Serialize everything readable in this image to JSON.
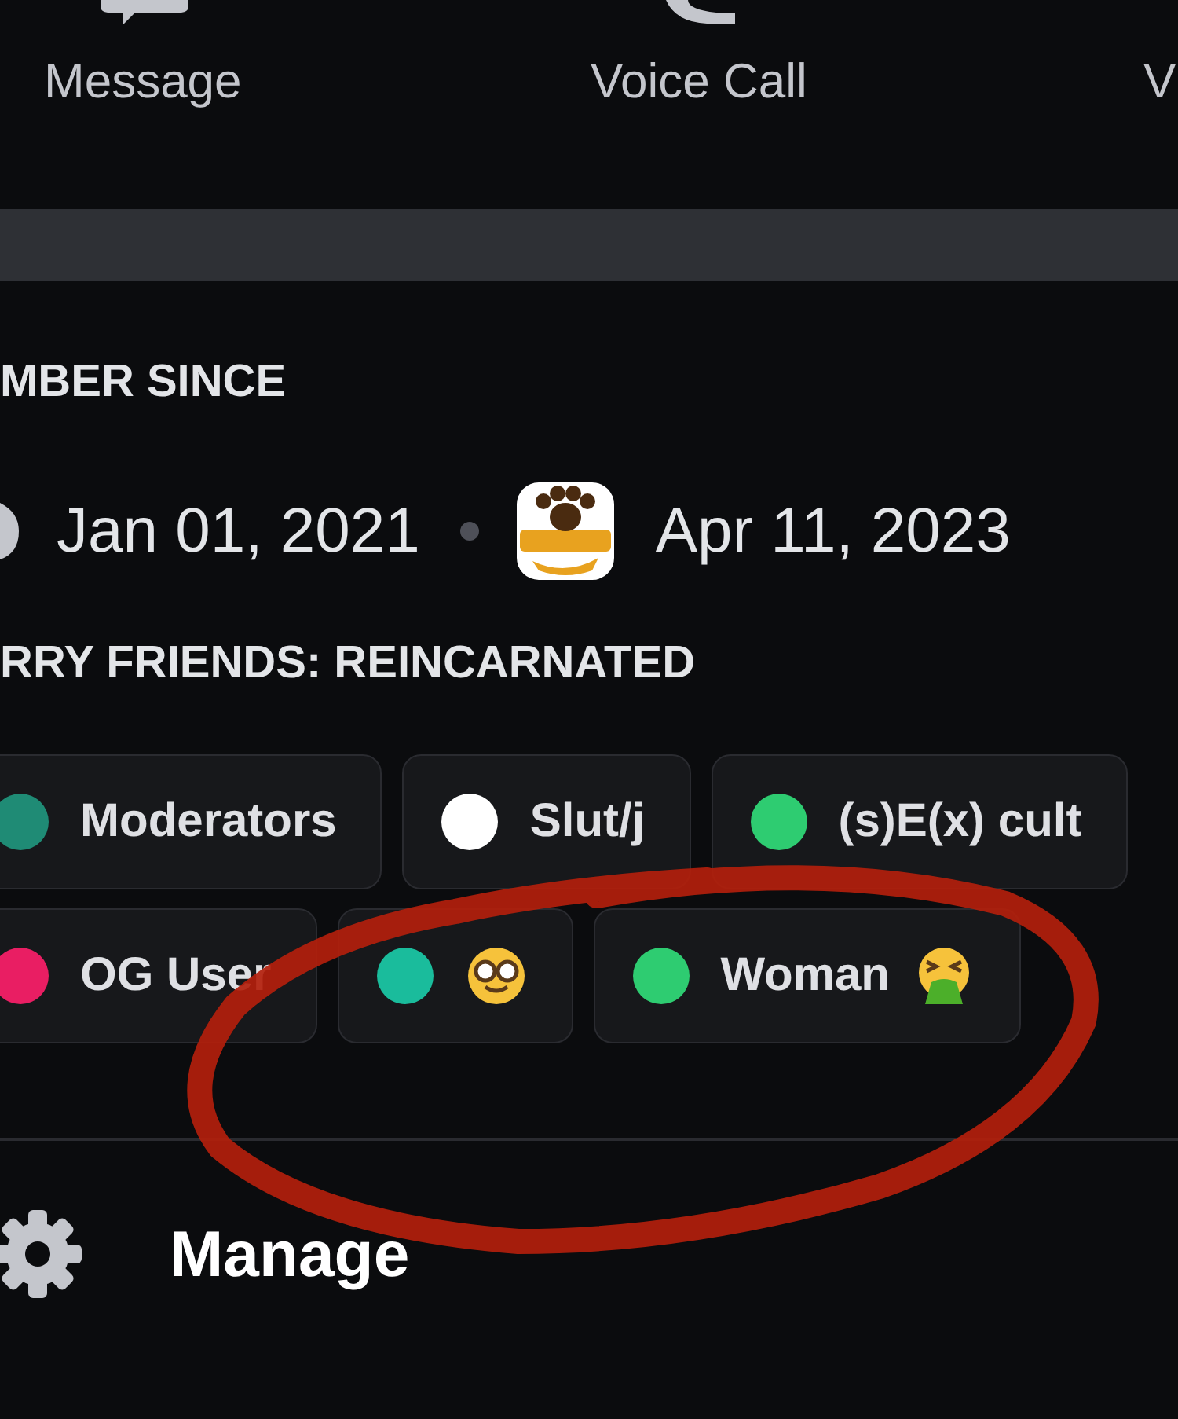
{
  "actions": [
    {
      "kind": "message",
      "label": "Message"
    },
    {
      "kind": "call",
      "label": "Voice Call"
    },
    {
      "kind": "video",
      "label": "V"
    }
  ],
  "member_since": {
    "heading": "MBER SINCE",
    "discord_date": "Jan 01, 2021",
    "server_date": "Apr 11, 2023"
  },
  "roles": {
    "heading": "RRY FRIENDS: REINCARNATED",
    "rows": [
      [
        {
          "kind": "plain",
          "name": "Moderators",
          "color": "#1f8b75"
        },
        {
          "kind": "plain",
          "name": "Slut/j",
          "color": "#ffffff"
        },
        {
          "kind": "plain",
          "name": "(s)E(x) cult",
          "color": "#2ecc71"
        }
      ],
      [
        {
          "kind": "plain",
          "name": "OG User",
          "color": "#e91e63"
        },
        {
          "kind": "nerd",
          "color": "#1abc9c"
        },
        {
          "kind": "nauseated",
          "name": "Woman",
          "color": "#2ecc71"
        }
      ]
    ]
  },
  "manage": {
    "label": "Manage"
  }
}
